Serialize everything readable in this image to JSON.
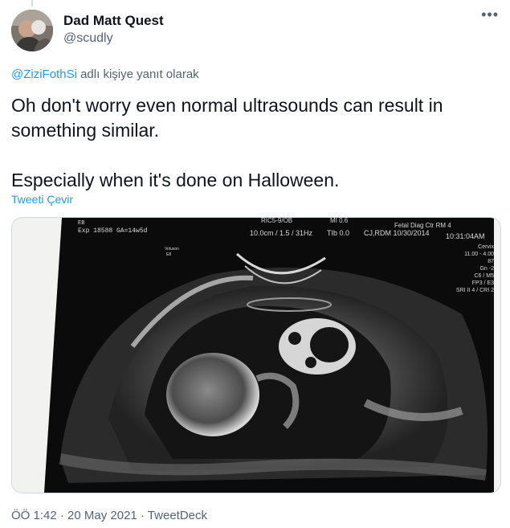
{
  "author": {
    "name": "Dad Matt Quest",
    "handle": "@scudly"
  },
  "more_icon": "more-horizontal-icon",
  "reply_context": {
    "mention": "@ZiziFothSi",
    "suffix": " adlı kişiye yanıt olarak"
  },
  "tweet": {
    "line1": "Oh don't worry even normal ultrasounds can result in something similar.",
    "line2": "Especially when it's done on Halloween."
  },
  "translate_label": "Tweeti Çevir",
  "media": {
    "header_left_1": "EB",
    "header_left_2": "Exp  18588  GA=14w5d",
    "header_center_top": "RIC5-9/OB",
    "header_center": "10.0cm / 1.5 / 31Hz",
    "header_mi": "MI 0.6",
    "header_tib": "TIb 0.0",
    "header_facility": "Fetal Diag Ctr RM 4",
    "header_op": "CJ,RDM 10/30/2014",
    "header_time": "10:31:04AM",
    "right_panel": [
      "Cervix",
      "11.00 - 4.00",
      "87",
      "Gn -2",
      "C6 / M5",
      "FP3 / E3",
      "SRI II 4 / CRI 2"
    ],
    "left_small_1": "Voluson",
    "left_small_2": "E8"
  },
  "meta": "ÖÖ 1:42 · 20 May 2021 · TweetDeck"
}
